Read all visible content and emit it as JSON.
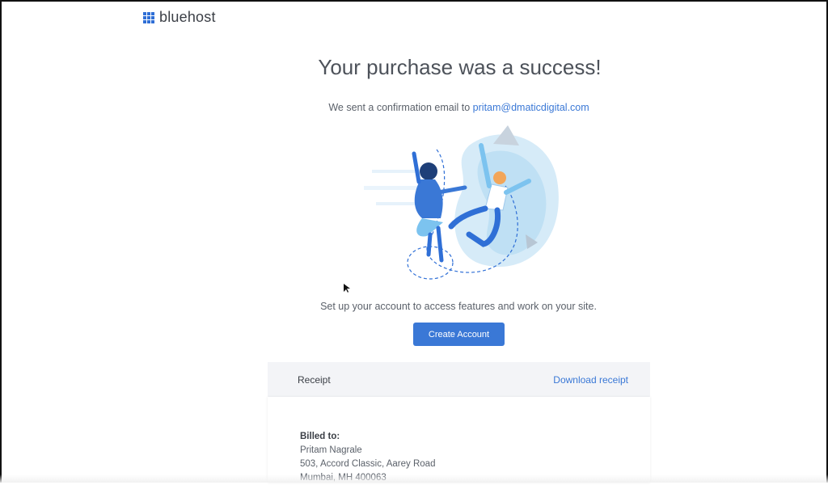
{
  "brand": {
    "name": "bluehost",
    "accent": "#3a78d6"
  },
  "hero": {
    "title": "Your purchase was a success!",
    "confirmation_prefix": "We sent a confirmation email to",
    "email": "pritam@dmaticdigital.com",
    "setup_text": "Set up your account to access features and work on your site.",
    "cta_label": "Create Account"
  },
  "receipt": {
    "title": "Receipt",
    "download_label": "Download receipt",
    "billed_label": "Billed to:",
    "name": "Pritam Nagrale",
    "address_line1": "503, Accord Classic, Aarey Road",
    "address_line2": "Mumbai, MH 400063"
  }
}
